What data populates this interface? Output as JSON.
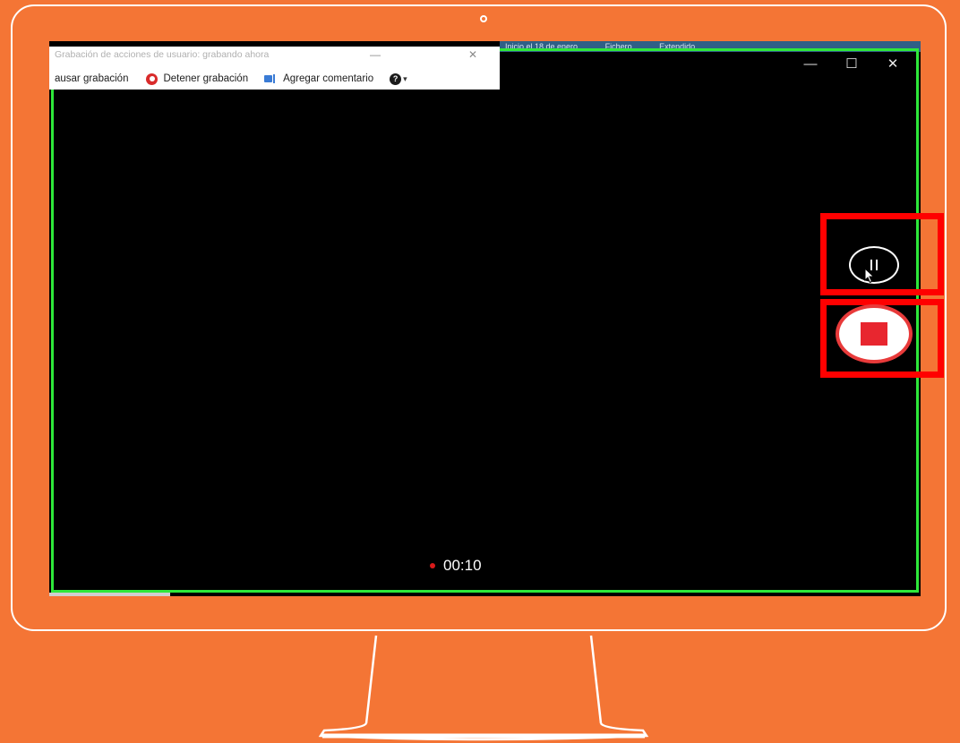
{
  "recorder": {
    "title": "Grabación de acciones de usuario: grabando ahora",
    "toolbar": {
      "pause_label": "ausar grabación",
      "stop_label": "Detener grabación",
      "comment_label": "Agregar comentario",
      "help_glyph": "?",
      "help_dropdown_glyph": "▾"
    }
  },
  "desktop_taskbar": {
    "items": [
      "Inicio el 18 de enero",
      "Fichero",
      "Extendido"
    ]
  },
  "window_controls": {
    "minimize": "—",
    "maximize": "☐",
    "close": "✕"
  },
  "recording": {
    "elapsed": "00:10"
  },
  "colors": {
    "background": "#F47535",
    "highlight": "#FF0000",
    "recording_border": "#2EE83A",
    "stop_button": "#E8262F"
  }
}
